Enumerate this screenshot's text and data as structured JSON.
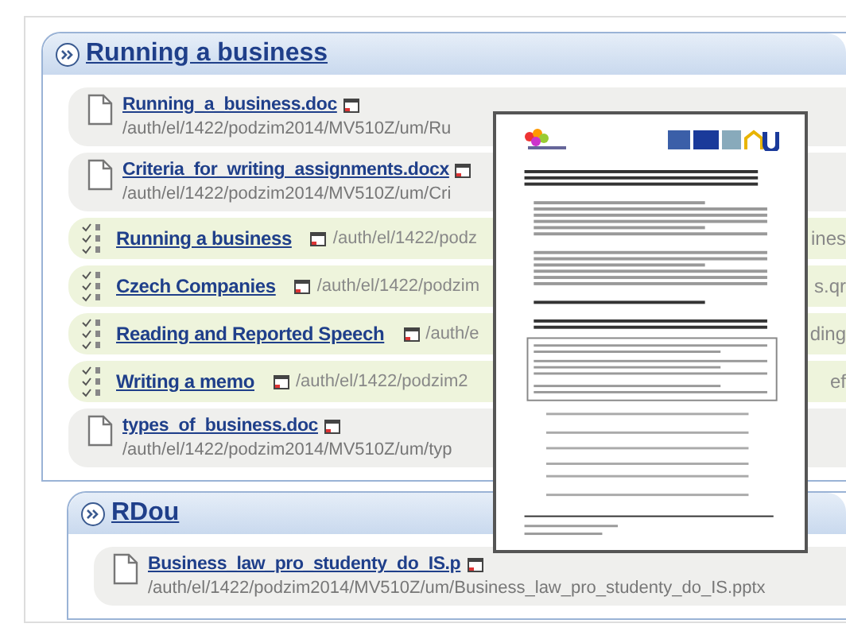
{
  "sections": [
    {
      "title": "Running a business",
      "items": [
        {
          "kind": "file",
          "title": "Running_a_business.doc",
          "path": "/auth/el/1422/podzim2014/MV510Z/um/Ru"
        },
        {
          "kind": "file",
          "title": "Criteria_for_writing_assignments.docx",
          "path": "/auth/el/1422/podzim2014/MV510Z/um/Cri"
        },
        {
          "kind": "quiz",
          "title": "Running a business",
          "path": "/auth/el/1422/podz",
          "tail": "ines"
        },
        {
          "kind": "quiz",
          "title": "Czech Companies",
          "path": "/auth/el/1422/podzim",
          "tail": "s.qr"
        },
        {
          "kind": "quiz",
          "title": "Reading and Reported Speech",
          "path": "/auth/e",
          "tail": "ding"
        },
        {
          "kind": "quiz",
          "title": "Writing a memo",
          "path": "/auth/el/1422/podzim2",
          "tail": "ef"
        },
        {
          "kind": "file",
          "title": "types_of_business.doc",
          "path": "/auth/el/1422/podzim2014/MV510Z/um/typ"
        }
      ]
    },
    {
      "title": "RDou",
      "items": [
        {
          "kind": "file",
          "title": "Business_law_pro_studenty_do_IS.p",
          "path": "/auth/el/1422/podzim2014/MV510Z/um/Business_law_pro_studenty_do_IS.pptx"
        }
      ]
    }
  ]
}
